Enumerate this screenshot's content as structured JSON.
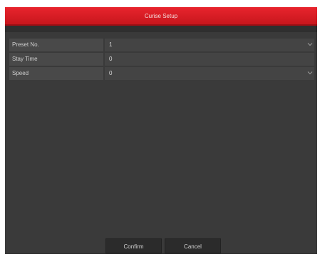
{
  "dialog": {
    "title": "Curise Setup"
  },
  "form": {
    "rows": [
      {
        "label": "Preset No.",
        "value": "1",
        "has_dropdown": true
      },
      {
        "label": "Stay Time",
        "value": "0",
        "has_dropdown": false
      },
      {
        "label": "Speed",
        "value": "0",
        "has_dropdown": true
      }
    ]
  },
  "buttons": {
    "confirm_label": "Confirm",
    "cancel_label": "Cancel"
  },
  "icons": {
    "dropdown": "chevron-down-icon"
  },
  "colors": {
    "title_bar": "#d81f26",
    "panel": "#3a3a3a",
    "row_label": "#494949",
    "row_value": "#444444"
  }
}
